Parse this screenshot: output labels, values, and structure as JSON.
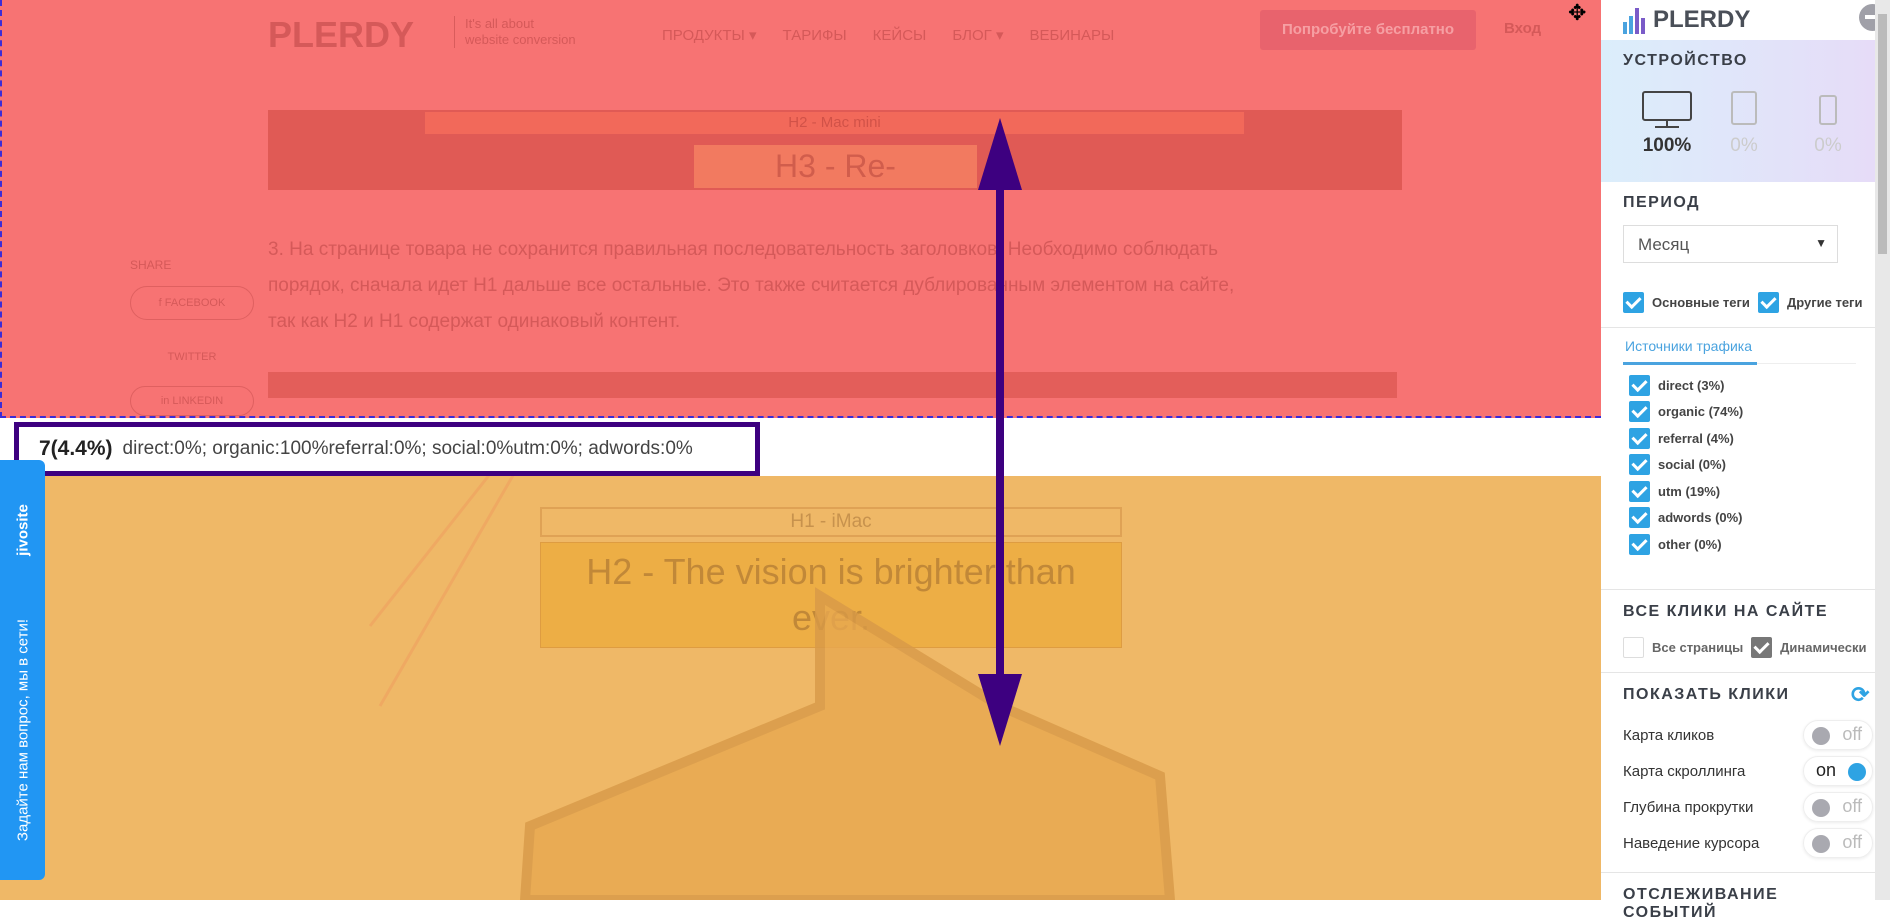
{
  "site": {
    "logo": "PLERDY",
    "tagline_1": "It's all about",
    "tagline_2": "website conversion",
    "nav": [
      "ПРОДУКТЫ ▾",
      "ТАРИФЫ",
      "КЕЙСЫ",
      "БЛОГ ▾",
      "ВЕБИНАРЫ"
    ],
    "cta": "Попробуйте бесплатно",
    "login": "Вход",
    "h2_top": "H2 - Mac mini",
    "h3": "H3 - Re-",
    "paragraph": [
      "3. На странице товара не сохранится правильная последовательность заголовков. Необходимо соблюдать",
      "порядок, сначала идет H1 дальше все остальные. Это также считается дублированным элементом на сайте,",
      "так как H2 и H1 содержат одинаковый контент."
    ],
    "share": "SHARE",
    "share_buttons": [
      "f FACEBOOK",
      "TWITTER",
      "in LINKEDIN"
    ],
    "h1_bottom": "H1 - iMac",
    "h2_bottom": "H2 - The vision is brighter than ever."
  },
  "tooltip": {
    "count": "7(4.4%)",
    "details": "direct:0%; organic:100%referral:0%; social:0%utm:0%; adwords:0%"
  },
  "jivosite": {
    "brand": "jivosite",
    "text": "Задайте нам вопрос, мы в сети!"
  },
  "colors": {
    "accent": "#2ea3e3",
    "arrow": "#3d0080",
    "hot": "#f77373",
    "warm": "#efb867",
    "jivo": "#2196f3"
  },
  "panel": {
    "logo": "PLERDY",
    "device": {
      "title": "УСТРОЙСТВО",
      "items": [
        {
          "icon": "desktop-icon",
          "value": "100%"
        },
        {
          "icon": "tablet-icon",
          "value": "0%"
        },
        {
          "icon": "mobile-icon",
          "value": "0%"
        }
      ]
    },
    "period": {
      "title": "ПЕРИОД",
      "selected": "Месяц"
    },
    "tags": [
      {
        "label": "Основные теги",
        "checked": true
      },
      {
        "label": "Другие теги",
        "checked": true
      }
    ],
    "traffic_tab": "Источники трафика",
    "sources": [
      {
        "label": "direct (3%)",
        "checked": true
      },
      {
        "label": "organic (74%)",
        "checked": true
      },
      {
        "label": "referral (4%)",
        "checked": true
      },
      {
        "label": "social (0%)",
        "checked": true
      },
      {
        "label": "utm (19%)",
        "checked": true
      },
      {
        "label": "adwords (0%)",
        "checked": true
      },
      {
        "label": "other (0%)",
        "checked": true
      }
    ],
    "all_clicks": {
      "title": "ВСЕ КЛИКИ НА САЙТЕ",
      "options": [
        {
          "label": "Все страницы",
          "checked": false
        },
        {
          "label": "Динамически",
          "checked": true
        }
      ]
    },
    "show_clicks": {
      "title": "ПОКАЗАТЬ КЛИКИ",
      "toggles": [
        {
          "label": "Карта кликов",
          "state": "off"
        },
        {
          "label": "Карта скроллинга",
          "state": "on"
        },
        {
          "label": "Глубина прокрутки",
          "state": "off"
        },
        {
          "label": "Наведение курсора",
          "state": "off"
        }
      ]
    },
    "events_title": "ОТСЛЕЖИВАНИЕ СОБЫТИЙ"
  }
}
